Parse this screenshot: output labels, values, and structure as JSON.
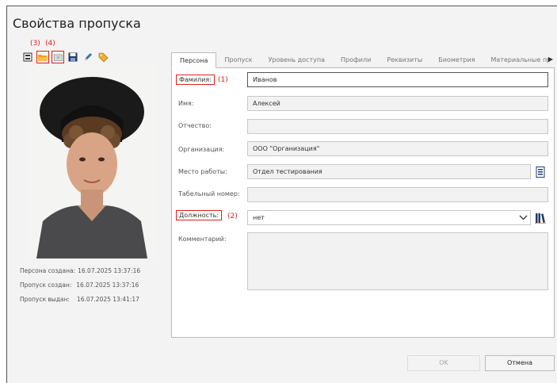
{
  "window": {
    "title": "Свойства пропуска"
  },
  "annotations": {
    "a3": "(3)",
    "a4": "(4)",
    "a1": "(1)",
    "a2": "(2)"
  },
  "toolbar": {
    "icons": [
      "scan-icon",
      "open-folder-icon",
      "camera-icon",
      "save-icon",
      "pen-icon",
      "tag-icon"
    ]
  },
  "info": {
    "person_created_label": "Персона создана:",
    "person_created_value": "16.07.2025 13:37:16",
    "pass_created_label": "Пропуск создан:",
    "pass_created_value": "16.07.2025 13:37:16",
    "pass_issued_label": "Пропуск выдан:",
    "pass_issued_value": "16.07.2025 13:41:17"
  },
  "tabs": [
    {
      "label": "Персона"
    },
    {
      "label": "Пропуск"
    },
    {
      "label": "Уровень доступа"
    },
    {
      "label": "Профили"
    },
    {
      "label": "Реквизиты"
    },
    {
      "label": "Биометрия"
    },
    {
      "label": "Материальные пр"
    }
  ],
  "form": {
    "surname_label": "Фамилия:",
    "surname_value": "Иванов",
    "name_label": "Имя:",
    "name_value": "Алексей",
    "patronymic_label": "Отчество:",
    "patronymic_value": "",
    "org_label": "Организация:",
    "org_value": "ООО \"Организация\"",
    "workplace_label": "Место работы:",
    "workplace_value": "Отдел тестирования",
    "tabnum_label": "Табельный номер:",
    "tabnum_value": "",
    "position_label": "Должность:",
    "position_value": "нет",
    "comment_label": "Комментарий:",
    "comment_value": ""
  },
  "buttons": {
    "ok": "OK",
    "cancel": "Отмена"
  },
  "colors": {
    "annotation": "#e02020",
    "accent_orange": "#f0a020",
    "navy": "#1f3b6e"
  }
}
